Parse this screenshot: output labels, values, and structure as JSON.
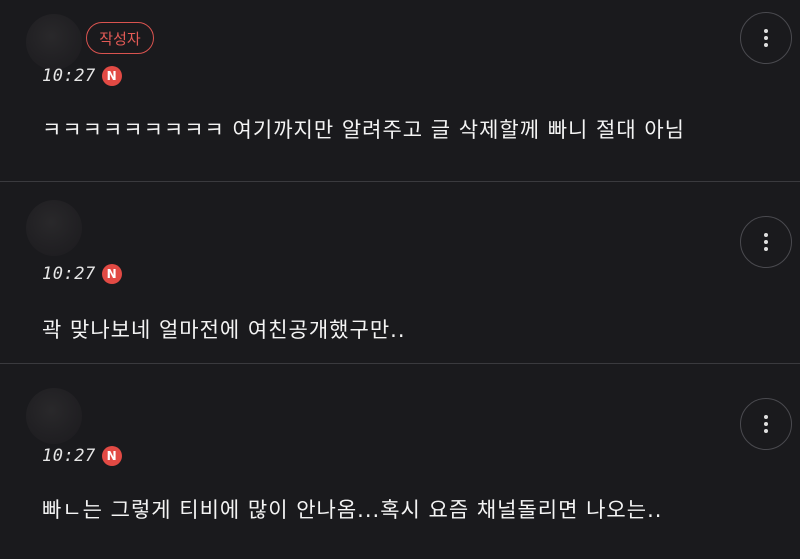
{
  "comments": [
    {
      "author_badge": "작성자",
      "time": "10:27",
      "source_badge": "N",
      "text": "ㅋㅋㅋㅋㅋㅋㅋㅋㅋ 여기까지만 알려주고 글 삭제할께 빠니 절대 아님"
    },
    {
      "time": "10:27",
      "source_badge": "N",
      "text": "곽 맞나보네 얼마전에 여친공개했구만.."
    },
    {
      "time": "10:27",
      "source_badge": "N",
      "text": "빠ㄴ는 그렇게 티비에 많이 안나옴...혹시 요즘 채널돌리면 나오는.."
    }
  ],
  "icons": {
    "more": "more-vertical-icon",
    "avatar": "avatar",
    "accent_color": "#e24a44"
  }
}
